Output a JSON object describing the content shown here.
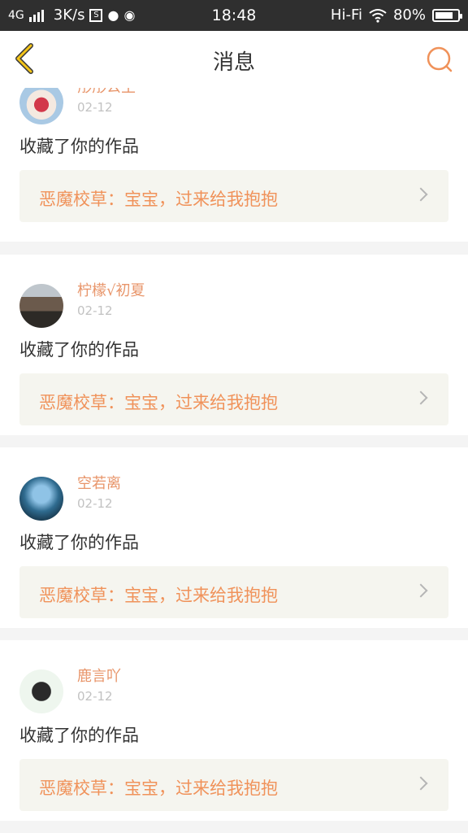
{
  "status": {
    "network": "4G",
    "speed": "3K/s",
    "time": "18:48",
    "hifi": "Hi-Fi",
    "battery": "80%",
    "battery_level": 0.8
  },
  "nav": {
    "title": "消息"
  },
  "messages": [
    {
      "username": "彤彤公主",
      "date": "02-12",
      "action": "收藏了你的作品",
      "ref": "恶魔校草：宝宝，过来给我抱抱",
      "avatar_color": "#9fbfd9"
    },
    {
      "username": "柠檬√初夏",
      "date": "02-12",
      "action": "收藏了你的作品",
      "ref": "恶魔校草：宝宝，过来给我抱抱",
      "avatar_color": "#7a6a5c"
    },
    {
      "username": "空若离",
      "date": "02-12",
      "action": "收藏了你的作品",
      "ref": "恶魔校草：宝宝，过来给我抱抱",
      "avatar_color": "#2f6b8f"
    },
    {
      "username": "鹿言吖",
      "date": "02-12",
      "action": "收藏了你的作品",
      "ref": "恶魔校草：宝宝，过来给我抱抱",
      "avatar_color": "#3a4a3a"
    }
  ],
  "colors": {
    "accent": "#f0925a",
    "back_icon": "#f5c518",
    "status_bar": "#2f2f2f"
  }
}
